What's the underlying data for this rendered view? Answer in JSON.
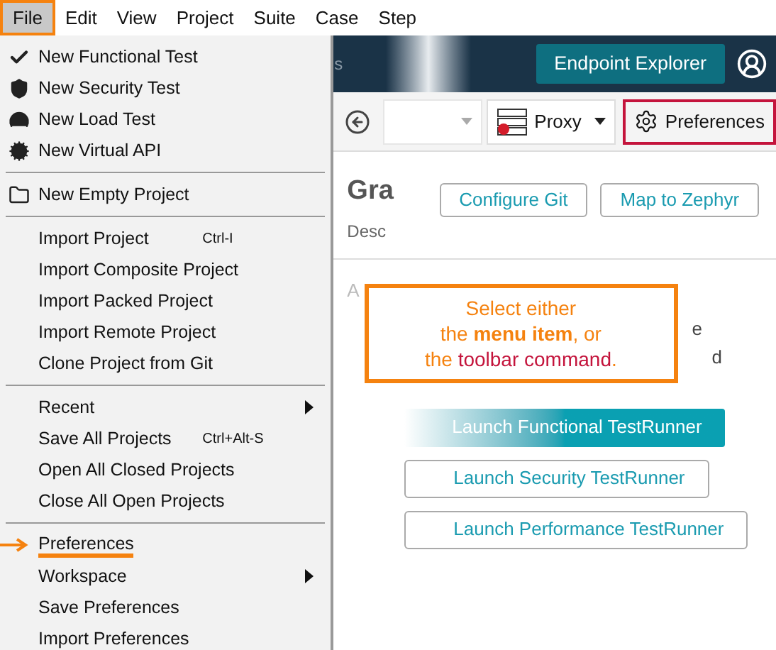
{
  "menu_bar": [
    {
      "label": "File",
      "selected": true
    },
    {
      "label": "Edit",
      "selected": false
    },
    {
      "label": "View",
      "selected": false
    },
    {
      "label": "Project",
      "selected": false
    },
    {
      "label": "Suite",
      "selected": false
    },
    {
      "label": "Case",
      "selected": false
    },
    {
      "label": "Step",
      "selected": false
    }
  ],
  "file_menu": [
    {
      "kind": "item",
      "label": "New Functional Test"
    },
    {
      "kind": "item",
      "label": "New Security Test"
    },
    {
      "kind": "item",
      "label": "New Load Test"
    },
    {
      "kind": "item",
      "label": "New Virtual API"
    },
    {
      "kind": "separator"
    },
    {
      "kind": "item",
      "label": "New Empty Project"
    },
    {
      "kind": "separator"
    },
    {
      "kind": "item",
      "label": "Import Project",
      "shortcut": "Ctrl-I"
    },
    {
      "kind": "item",
      "label": "Import Composite Project"
    },
    {
      "kind": "item",
      "label": "Import Packed Project"
    },
    {
      "kind": "item",
      "label": "Import Remote Project"
    },
    {
      "kind": "item",
      "label": "Clone Project from Git"
    },
    {
      "kind": "separator"
    },
    {
      "kind": "item",
      "label": "Recent",
      "submenu": true
    },
    {
      "kind": "item",
      "label": "Save All Projects",
      "shortcut": "Ctrl+Alt-S"
    },
    {
      "kind": "item",
      "label": "Open All Closed Projects"
    },
    {
      "kind": "item",
      "label": "Close All Open Projects"
    },
    {
      "kind": "separator"
    },
    {
      "kind": "item",
      "label": "Preferences",
      "highlighted": true
    },
    {
      "kind": "item",
      "label": "Workspace",
      "submenu": true
    },
    {
      "kind": "item",
      "label": "Save Preferences"
    },
    {
      "kind": "item",
      "label": "Import Preferences"
    }
  ],
  "header": {
    "fragment": "s",
    "endpoint_button": "Endpoint Explorer"
  },
  "toolbar": {
    "proxy": "Proxy",
    "preferences": {
      "label": "Preferences",
      "highlighted": true
    }
  },
  "content": {
    "title": "Gra",
    "description": "Desc",
    "buttons": [
      "Configure Git",
      "Map to Zephyr"
    ],
    "fragments": [
      "A",
      "e",
      "d"
    ],
    "launch_buttons": [
      {
        "label": "Launch Functional TestRunner",
        "primary": true
      },
      {
        "label": "Launch Security TestRunner",
        "primary": false
      },
      {
        "label": "Launch Performance TestRunner",
        "primary": false
      }
    ]
  },
  "callout": {
    "lines": [
      "Select either",
      "the **menu item**, or"
    ],
    "line3_prefix": "the ",
    "line3_command": "toolbar command",
    "line3_suffix": "."
  }
}
